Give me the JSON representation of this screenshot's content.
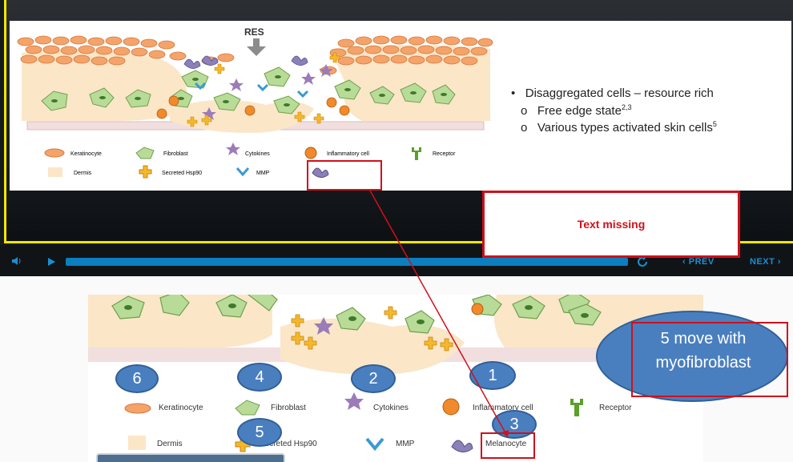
{
  "slide": {
    "res_label": "RES",
    "legend_top": {
      "keratinocyte": "Keratinocyte",
      "fibroblast": "Fibroblast",
      "cytokines": "Cytokines",
      "inflammatory": "Inflammatory cell",
      "receptor": "Receptor",
      "dermis": "Dermis",
      "hsp90": "Secreted Hsp90",
      "mmp": "MMP"
    },
    "bullet_main": "Disaggregated cells – resource rich",
    "bullet_sub1": "Free edge state",
    "bullet_sub1_sup": "2,3",
    "bullet_sub2": "Various types activated skin cells",
    "bullet_sub2_sup": "5"
  },
  "player": {
    "prev_label": "PREV",
    "next_label": "NEXT",
    "progress": 0.98
  },
  "annotations": {
    "text_missing": "Text missing",
    "ellipse_text": "5 move with myofibroblast",
    "n1": "1",
    "n2": "2",
    "n3": "3",
    "n4": "4",
    "n5": "5",
    "n6": "6"
  },
  "zoom_legend": {
    "keratinocyte": "Keratinocyte",
    "fibroblast": "Fibroblast",
    "cytokines": "Cytokines",
    "inflammatory": "Inflammatory cell",
    "receptor": "Receptor",
    "dermis": "Dermis",
    "hsp90": "Secreted Hsp90",
    "mmp": "MMP",
    "melanocyte": "Melanocyte"
  },
  "colors": {
    "annotation_red": "#d0101a",
    "bubble_blue": "#4a7fbf",
    "player_blue": "#0b7fbf",
    "frame_yellow": "#f2e600"
  }
}
